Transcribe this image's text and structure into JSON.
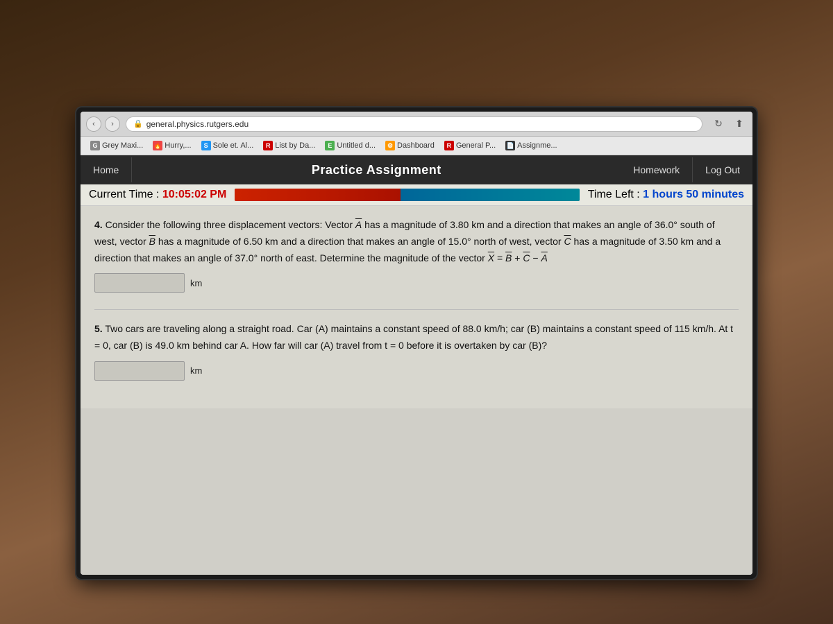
{
  "browser": {
    "address": "general.physics.rutgers.edu",
    "refresh_icon": "↻",
    "share_icon": "⬆"
  },
  "bookmarks": [
    {
      "id": "grey-maxi",
      "label": "Grey Maxi...",
      "favicon_class": "favicon-grey",
      "favicon_text": "G"
    },
    {
      "id": "hurry",
      "label": "Hurry,...",
      "favicon_class": "favicon-nova",
      "favicon_text": "🔥"
    },
    {
      "id": "sole",
      "label": "Sole et. Al...",
      "favicon_class": "favicon-sole",
      "favicon_text": "S"
    },
    {
      "id": "list-by-da",
      "label": "List by Da...",
      "favicon_class": "favicon-r-list",
      "favicon_text": "R"
    },
    {
      "id": "untitled",
      "label": "Untitled d...",
      "favicon_class": "favicon-untitled",
      "favicon_text": "E"
    },
    {
      "id": "dashboard",
      "label": "Dashboard",
      "favicon_class": "favicon-dashboard",
      "favicon_text": "⚙"
    },
    {
      "id": "general-p",
      "label": "General P...",
      "favicon_class": "favicon-general-p",
      "favicon_text": "R"
    },
    {
      "id": "assignme",
      "label": "Assignme...",
      "favicon_class": "favicon-assign",
      "favicon_text": "📄"
    }
  ],
  "site_nav": {
    "home": "Home",
    "title": "Practice Assignment",
    "homework": "Homework",
    "logout": "Log Out"
  },
  "timer": {
    "current_time_label": "Current Time : ",
    "current_time_value": "10:05:02 PM",
    "time_left_label": "Time Left : ",
    "time_left_value": "1 hours 50 minutes"
  },
  "questions": [
    {
      "number": "4.",
      "text_parts": [
        "Consider the following three displacement vectors: Vector ",
        "A",
        " has a magnitude of 3.80 km and a direction that makes an angle of 36.0° south of west, vector ",
        "B",
        " has a magnitude of 6.50 km and a direction that makes an angle of 15.0° north of west, vector ",
        "C",
        " has a magnitude of 3.50 km and a direction that makes an angle of 37.0° north of east. Determine the magnitude of the vector ",
        "X",
        " = ",
        "B",
        " + ",
        "C",
        " − ",
        "A"
      ],
      "unit": "km",
      "input_placeholder": ""
    },
    {
      "number": "5.",
      "text": "Two cars are traveling along a straight road. Car (A) maintains a constant speed of 88.0 km/h; car (B) maintains a constant speed of 115 km/h. At t = 0, car (B) is 49.0 km behind car A. How far will car (A) travel from t = 0 before it is overtaken by car (B)?",
      "unit": "km",
      "input_placeholder": ""
    }
  ]
}
